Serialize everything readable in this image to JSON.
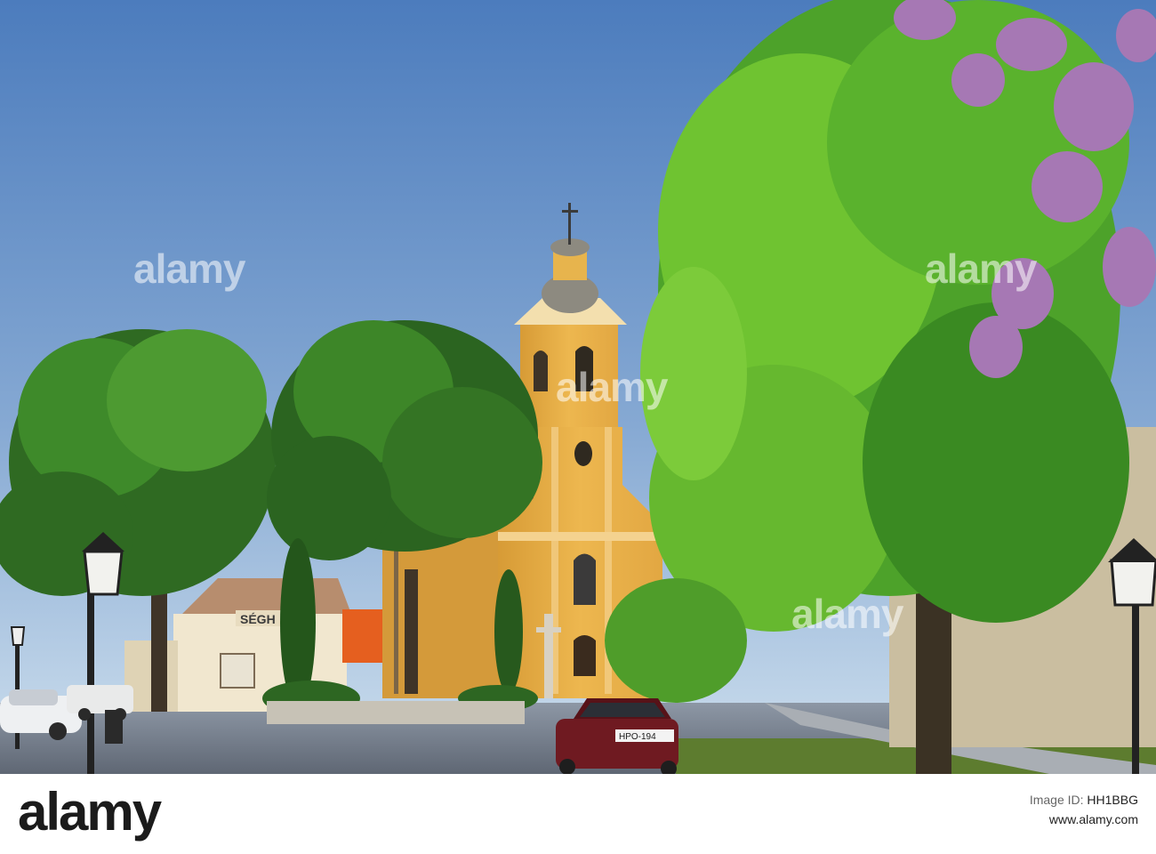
{
  "watermark": {
    "text": "alamy"
  },
  "footer": {
    "logo": "alamy",
    "image_id_label": "Image ID:",
    "image_id": "HH1BBG",
    "site": "www.alamy.com"
  },
  "scene": {
    "sign_left": "SÉGH",
    "license_plate": "HPO-194"
  },
  "colors": {
    "sky_top": "#4f7fbf",
    "sky_bottom": "#c9dcec",
    "church": "#e9b049",
    "tree_dark": "#2f6a22",
    "tree_bright": "#6fc331",
    "blossom": "#a678b4"
  }
}
